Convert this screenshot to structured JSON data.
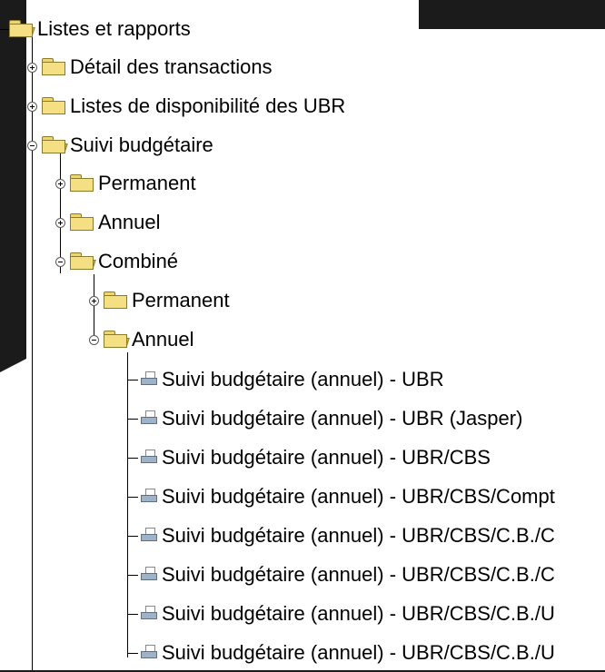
{
  "tree": {
    "root": {
      "label": "Listes et rapports",
      "icon": "folder-open-icon"
    },
    "level1": [
      {
        "label": "Détail des transactions",
        "state": "collapsed"
      },
      {
        "label": "Listes de disponibilité des UBR",
        "state": "collapsed"
      },
      {
        "label": "Suivi budgétaire",
        "state": "expanded"
      }
    ],
    "suivi_children": [
      {
        "label": "Permanent",
        "state": "collapsed"
      },
      {
        "label": "Annuel",
        "state": "collapsed"
      },
      {
        "label": "Combiné",
        "state": "expanded"
      }
    ],
    "combine_children": [
      {
        "label": "Permanent",
        "state": "collapsed"
      },
      {
        "label": "Annuel",
        "state": "expanded"
      }
    ],
    "reports": [
      "Suivi budgétaire (annuel) - UBR",
      "Suivi budgétaire (annuel) - UBR (Jasper)",
      "Suivi budgétaire (annuel) - UBR/CBS",
      "Suivi budgétaire (annuel) - UBR/CBS/Compt",
      "Suivi budgétaire (annuel) - UBR/CBS/C.B./C",
      "Suivi budgétaire (annuel) - UBR/CBS/C.B./C",
      "Suivi budgétaire (annuel) - UBR/CBS/C.B./U",
      "Suivi budgétaire (annuel) - UBR/CBS/C.B./U"
    ]
  },
  "colors": {
    "background": "#ffffff",
    "frame": "#1b1b1b",
    "text": "#000000",
    "lines": "#000000"
  }
}
